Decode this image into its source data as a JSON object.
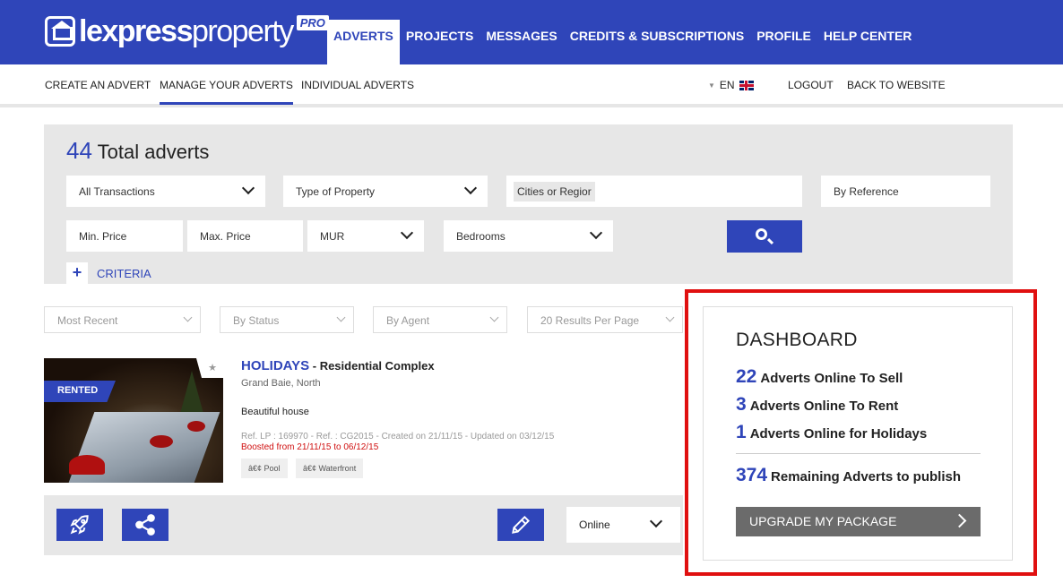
{
  "brand": {
    "name_bold": "lexpress",
    "name_light": "property",
    "badge": "PRO"
  },
  "main_nav": [
    {
      "label": "ADVERTS",
      "active": true
    },
    {
      "label": "PROJECTS"
    },
    {
      "label": "MESSAGES"
    },
    {
      "label": "CREDITS & SUBSCRIPTIONS"
    },
    {
      "label": "PROFILE"
    },
    {
      "label": "HELP CENTER"
    }
  ],
  "sub_nav": {
    "create": "CREATE AN ADVERT",
    "manage": "MANAGE YOUR ADVERTS",
    "individual": "INDIVIDUAL ADVERTS",
    "language": "EN",
    "logout": "LOGOUT",
    "back": "BACK TO WEBSITE"
  },
  "search": {
    "total_count": "44",
    "total_label": "Total adverts",
    "transactions": "All Transactions",
    "property_type": "Type of Property",
    "cities_placeholder": "Cities or Regior",
    "reference_placeholder": "By Reference",
    "min_price_placeholder": "Min. Price",
    "max_price_placeholder": "Max. Price",
    "currency": "MUR",
    "bedrooms": "Bedrooms",
    "criteria_plus": "+",
    "criteria_label": "CRITERIA"
  },
  "filters": {
    "sort": "Most Recent",
    "status": "By Status",
    "agent": "By Agent",
    "per_page": "20 Results Per Page"
  },
  "listing": {
    "badge": "RENTED",
    "title": "HOLIDAYS",
    "subtitle": " - Residential Complex",
    "location": "Grand Baie, North",
    "description": "Beautiful house",
    "refs": "Ref. LP : 169970 - Ref. : CG2015 - Created on 21/11/15 - Updated on 03/12/15",
    "boost": "Boosted from 21/11/15 to 06/12/15",
    "tags": [
      "â€¢ Pool",
      "â€¢ Waterfront"
    ],
    "status": "Online"
  },
  "dashboard": {
    "title": "DASHBOARD",
    "sell_count": "22",
    "sell_label": "Adverts Online To Sell",
    "rent_count": "3",
    "rent_label": "Adverts Online To Rent",
    "holiday_count": "1",
    "holiday_label": "Adverts Online for Holidays",
    "remaining_count": "374",
    "remaining_label": "Remaining Adverts to publish",
    "upgrade_label": "UPGRADE MY PACKAGE"
  },
  "colors": {
    "brand_blue": "#2f45b9",
    "panel_grey": "#e7e7e7",
    "boost_red": "#d01010",
    "highlight_red": "#e01010"
  }
}
